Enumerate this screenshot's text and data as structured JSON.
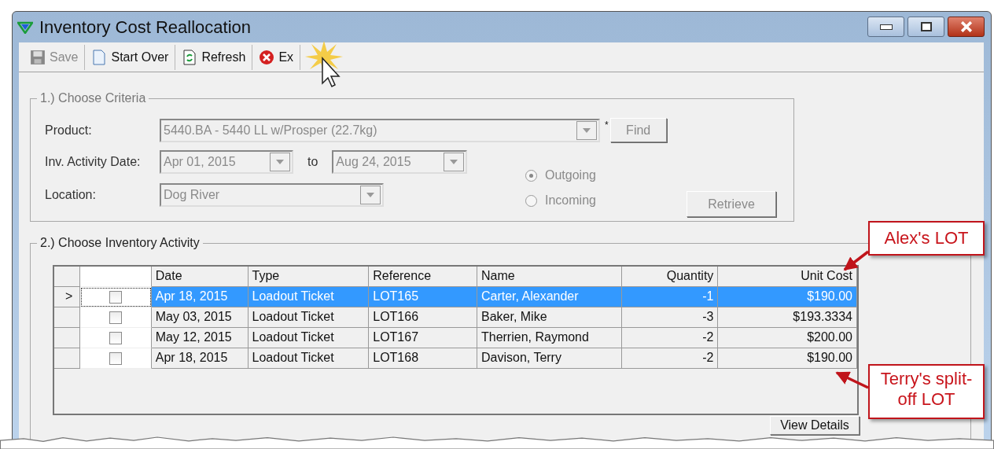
{
  "window": {
    "title": "Inventory Cost Reallocation"
  },
  "toolbar": [
    {
      "label": "Save",
      "kind": "save",
      "disabled": true
    },
    {
      "label": "Start Over",
      "kind": "page",
      "disabled": false
    },
    {
      "label": "Refresh",
      "kind": "refresh",
      "disabled": false
    },
    {
      "label": "Ex",
      "kind": "exit",
      "disabled": false
    }
  ],
  "criteria": {
    "title": "1.) Choose Criteria",
    "disabled": true,
    "product_label": "Product:",
    "product": "5440.BA - 5440 LL w/Prosper (22.7kg)",
    "required_mark": "*",
    "find_button": "Find",
    "date_label": "Inv. Activity Date:",
    "date_from": "Apr  01, 2015",
    "to_label": "to",
    "date_to": "Aug  24, 2015",
    "location_label": "Location:",
    "location": "Dog River",
    "direction": [
      {
        "label": "Outgoing",
        "selected": true
      },
      {
        "label": "Incoming",
        "selected": false
      }
    ],
    "retrieve_button": "Retrieve"
  },
  "activity": {
    "title": "2.) Choose Inventory Activity",
    "columns": [
      "Date",
      "Type",
      "Reference",
      "Name",
      "Quantity",
      "Unit Cost"
    ],
    "rows": [
      {
        "indicator": ">",
        "selected": true,
        "checked": false,
        "cells": [
          "Apr 18, 2015",
          "Loadout Ticket",
          "LOT165",
          "Carter, Alexander",
          "-1",
          "$190.00"
        ]
      },
      {
        "selected": false,
        "checked": false,
        "cells": [
          "May 03, 2015",
          "Loadout Ticket",
          "LOT166",
          "Baker, Mike",
          "-3",
          "$193.3334"
        ]
      },
      {
        "selected": false,
        "checked": false,
        "cells": [
          "May 12, 2015",
          "Loadout Ticket",
          "LOT167",
          "Therrien, Raymond",
          "-2",
          "$200.00"
        ]
      },
      {
        "selected": false,
        "checked": false,
        "cells": [
          "Apr 18, 2015",
          "Loadout Ticket",
          "LOT168",
          "Davison, Terry",
          "-2",
          "$190.00"
        ]
      }
    ],
    "details_button": "View Details"
  },
  "callouts": [
    {
      "text": "Alex's LOT"
    },
    {
      "text": "Terry's split-off LOT"
    }
  ]
}
